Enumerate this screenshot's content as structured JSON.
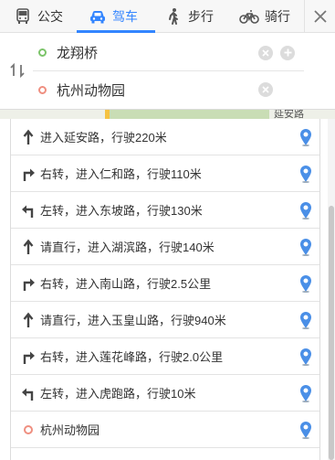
{
  "tabs": [
    {
      "label": "公交",
      "icon": "bus-icon"
    },
    {
      "label": "驾车",
      "icon": "car-icon"
    },
    {
      "label": "步行",
      "icon": "walk-icon"
    },
    {
      "label": "骑行",
      "icon": "bike-icon"
    }
  ],
  "active_tab": "驾车",
  "route": {
    "start": "龙翔桥",
    "end": "杭州动物园"
  },
  "map_label": "延安路",
  "steps": [
    {
      "dir": "straight",
      "text": "进入延安路，行驶220米"
    },
    {
      "dir": "right",
      "text": "右转，进入仁和路，行驶110米"
    },
    {
      "dir": "left",
      "text": "左转，进入东坡路，行驶130米"
    },
    {
      "dir": "straight",
      "text": "请直行，进入湖滨路，行驶140米"
    },
    {
      "dir": "right",
      "text": "右转，进入南山路，行驶2.5公里"
    },
    {
      "dir": "straight",
      "text": "请直行，进入玉皇山路，行驶940米"
    },
    {
      "dir": "right",
      "text": "右转，进入莲花峰路，行驶2.0公里"
    },
    {
      "dir": "left",
      "text": "左转，进入虎跑路，行驶10米"
    },
    {
      "dir": "end",
      "text": "杭州动物园"
    }
  ],
  "colors": {
    "accent": "#3385ff",
    "start_dot": "#7cc46a",
    "end_dot": "#ef8f80"
  }
}
